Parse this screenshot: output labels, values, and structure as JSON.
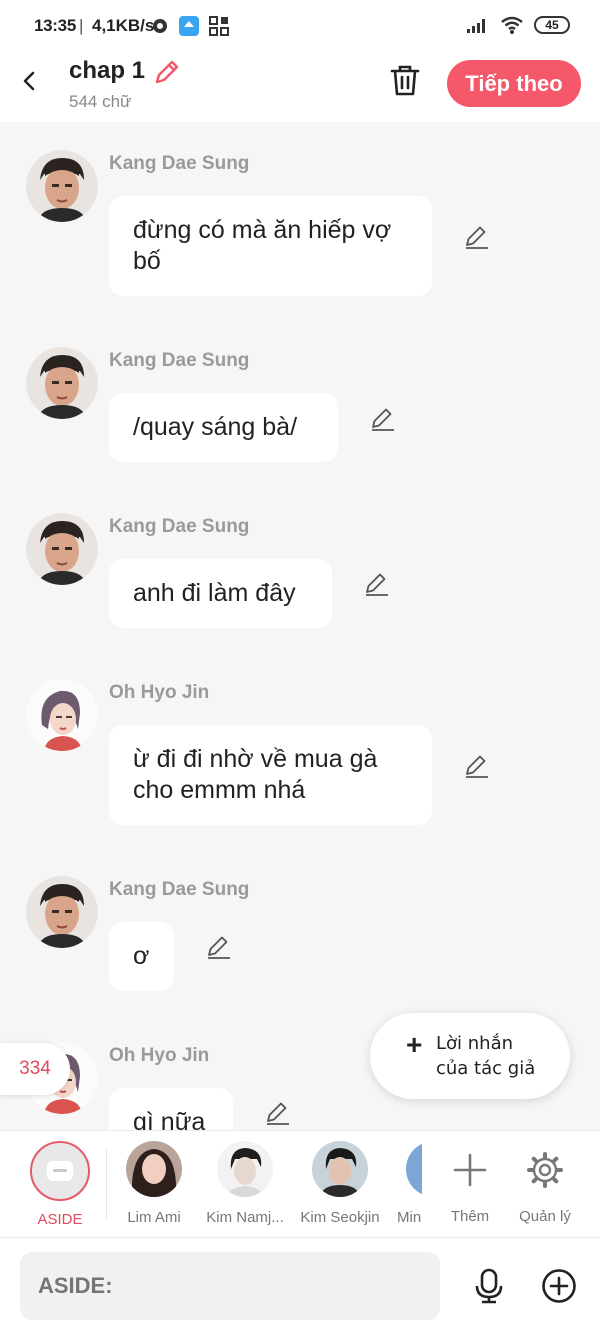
{
  "status": {
    "time": "13:35",
    "separator": "|",
    "speed": "4,1KB/s",
    "battery": "45"
  },
  "header": {
    "title": "chap 1",
    "word_count": "544 chữ",
    "next_label": "Tiếp theo"
  },
  "messages": [
    {
      "sender": "Kang Dae Sung",
      "text": "đừng có mà ăn hiếp vợ bố"
    },
    {
      "sender": "Kang Dae Sung",
      "text": "/quay sáng bà/"
    },
    {
      "sender": "Kang Dae Sung",
      "text": "anh đi làm đây"
    },
    {
      "sender": "Oh Hyo Jin",
      "text": "ừ đi đi nhờ về mua gà cho emmm nhá"
    },
    {
      "sender": "Kang Dae Sung",
      "text": "ơ"
    },
    {
      "sender": "Oh Hyo Jin",
      "text": "gì nữa"
    }
  ],
  "side_badge": "334",
  "author_note": {
    "line1": "Lời nhắn",
    "line2": "của tác giả"
  },
  "characters": [
    {
      "label": "ASIDE"
    },
    {
      "label": "Lim Ami"
    },
    {
      "label": "Kim Namj..."
    },
    {
      "label": "Kim Seokjin"
    },
    {
      "label": "Min"
    },
    {
      "label": "Thêm"
    },
    {
      "label": "Quản lý"
    }
  ],
  "input": {
    "placeholder": "ASIDE:"
  },
  "colors": {
    "accent": "#f5576b",
    "background": "#f6f6f6"
  }
}
